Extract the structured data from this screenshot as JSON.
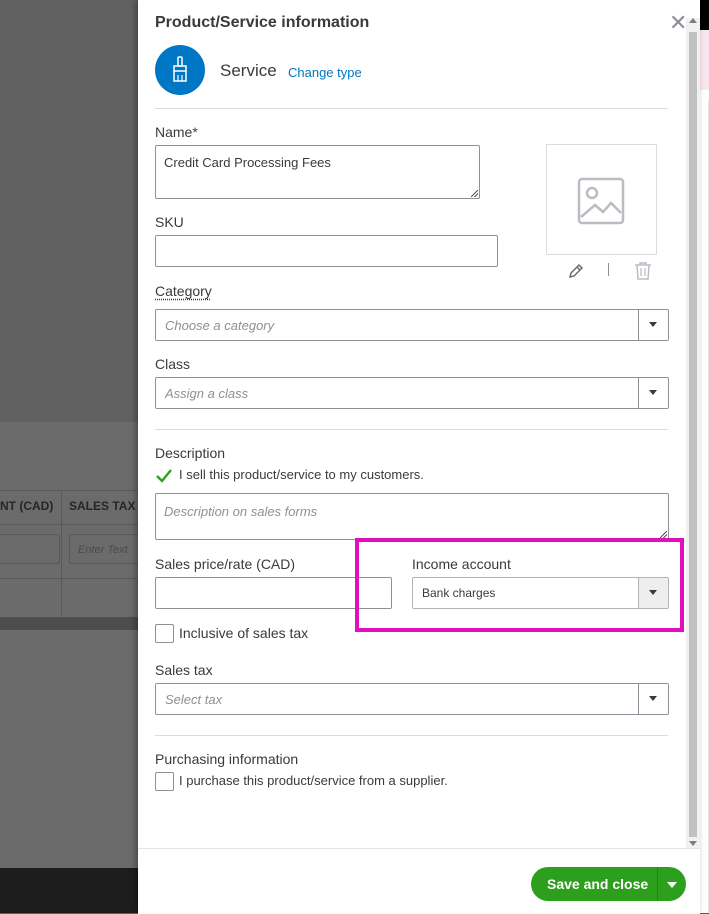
{
  "background": {
    "table_header_col1": "NT (CAD)",
    "table_header_col2": "SALES TAX",
    "input_placeholder": "Enter Text"
  },
  "panel": {
    "title": "Product/Service information",
    "type_label": "Service",
    "change_type": "Change type",
    "type_icon": "paintbrush-icon",
    "name": {
      "label": "Name*",
      "value": "Credit Card Processing Fees"
    },
    "sku": {
      "label": "SKU",
      "value": ""
    },
    "category": {
      "label": "Category",
      "placeholder": "Choose a category"
    },
    "class": {
      "label": "Class",
      "placeholder": "Assign a class"
    },
    "description": {
      "label": "Description",
      "sell_checkbox_label": "I sell this product/service to my customers.",
      "sell_checked": true,
      "placeholder": "Description on sales forms"
    },
    "sales_price": {
      "label": "Sales price/rate (CAD)",
      "value": ""
    },
    "income_account": {
      "label": "Income account",
      "value": "Bank charges"
    },
    "inclusive_tax": {
      "label": "Inclusive of sales tax",
      "checked": false
    },
    "sales_tax": {
      "label": "Sales tax",
      "placeholder": "Select tax"
    },
    "purchasing": {
      "label": "Purchasing information",
      "checkbox_label": "I purchase this product/service from a supplier.",
      "checked": false
    }
  },
  "footer": {
    "save_button": "Save and close"
  },
  "colors": {
    "accent_blue": "#0077c5",
    "save_green": "#2ca01c",
    "highlight_magenta": "#e20fbf"
  }
}
